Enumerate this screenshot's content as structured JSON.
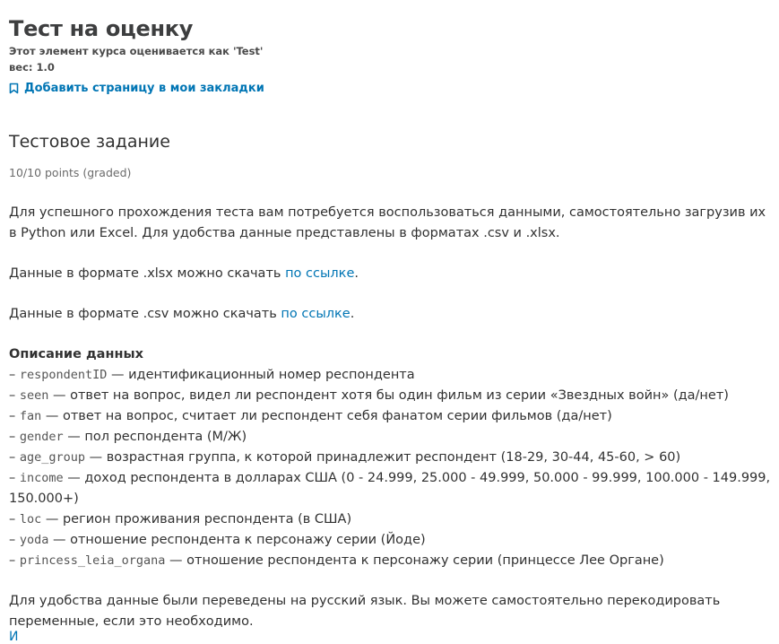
{
  "unit": {
    "title": "Тест на оценку",
    "grading_note": "Этот элемент курса оценивается как 'Test'",
    "weight": "вес: 1.0",
    "bookmark_label": "Добавить страницу в мои закладки"
  },
  "problem": {
    "title": "Тестовое задание",
    "points": "10/10 points (graded)",
    "intro": "Для успешного прохождения теста вам потребуется воспользоваться данными, самостоятельно загрузив их в Python или Excel. Для удобства данные представлены в форматах .csv и .xlsx.",
    "xlsx_prefix": "Данные в формате .xlsx можно скачать ",
    "xlsx_link": "по ссылке",
    "csv_prefix": "Данные в формате .csv можно скачать ",
    "csv_link": "по ссылке",
    "period": ".",
    "desc_title": "Описание данных",
    "fields": [
      {
        "name": "respondentID",
        "desc": " — идентификационный номер респондента"
      },
      {
        "name": "seen",
        "desc": " — ответ на вопрос, видел ли респондент хотя бы один фильм из серии «Звездных войн» (да/нет)"
      },
      {
        "name": "fan",
        "desc": " — ответ на вопрос, считает ли респондент себя фанатом серии фильмов (да/нет)"
      },
      {
        "name": "gender",
        "desc": " — пол респондента (М/Ж)"
      },
      {
        "name": "age_group",
        "desc": " — возрастная группа, к которой принадлежит респондент (18-29, 30-44, 45-60, > 60)"
      },
      {
        "name": "income",
        "desc": " — доход респондента в долларах США (0 - 24.999, 25.000 - 49.999, 50.000 - 99.999, 100.000 - 149.999, 150.000+)"
      },
      {
        "name": "loc",
        "desc": " — регион проживания респондента (в США)"
      },
      {
        "name": "yoda",
        "desc": " — отношение респондента к персонажу серии (Йоде)"
      },
      {
        "name": "princess_leia_organa",
        "desc": " — отношение респондента к персонажу серии (принцессе Лее Органе)"
      }
    ],
    "dash": "– ",
    "outro": "Для удобства данные были переведены на русский язык. Вы можете самостоятельно перекодировать переменные, если это необходимо.",
    "cut_text": "И"
  }
}
